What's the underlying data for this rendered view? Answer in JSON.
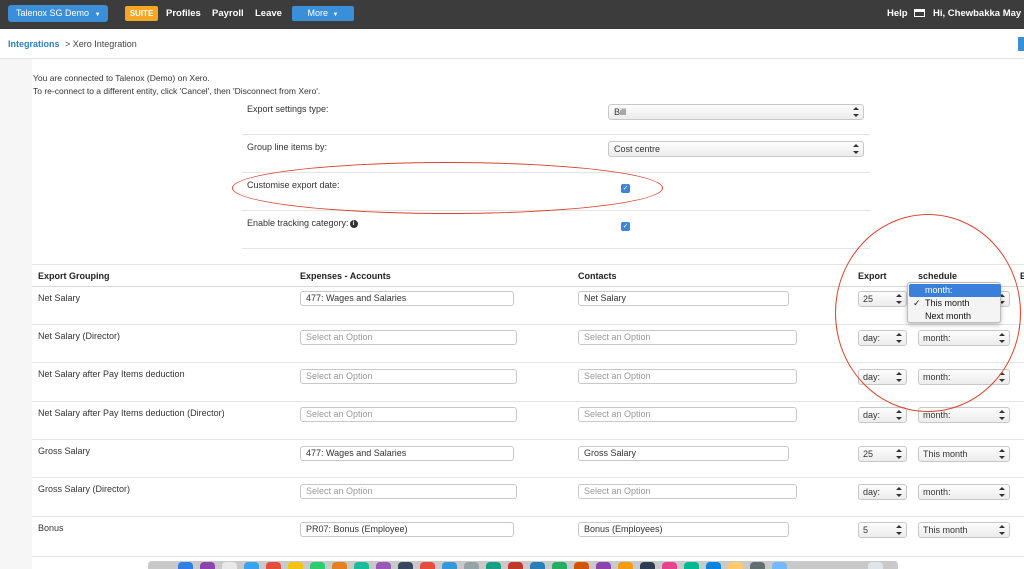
{
  "topnav": {
    "org_label": "Talenox SG Demo",
    "suite_label": "SUITE",
    "links": [
      "Profiles",
      "Payroll",
      "Leave"
    ],
    "more_label": "More",
    "help_label": "Help",
    "greeting": "Hi, Chewbakka May"
  },
  "breadcrumb": {
    "parent": "Integrations",
    "current": "> Xero Integration"
  },
  "info": {
    "line1": "You are connected to Talenox (Demo) on Xero.",
    "line2": "To re-connect to a different entity, click 'Cancel', then 'Disconnect from Xero'."
  },
  "settings": {
    "export_type_label": "Export settings type:",
    "export_type_value": "Bill",
    "group_by_label": "Group line items by:",
    "group_by_value": "Cost centre",
    "customise_date_label": "Customise export date:",
    "customise_date_checked": true,
    "tracking_label": "Enable tracking category:",
    "tracking_checked": true
  },
  "table": {
    "headers": {
      "grouping": "Export Grouping",
      "accounts": "Expenses - Accounts",
      "contacts": "Contacts",
      "export": "Export",
      "schedule": "schedule",
      "extra": "E"
    },
    "rows": [
      {
        "label": "Net Salary",
        "account": "477: Wages and Salaries",
        "account_placeholder": false,
        "contact": "Net Salary",
        "contact_placeholder": false,
        "day": "25",
        "schedule": "This month"
      },
      {
        "label": "Net Salary (Director)",
        "account": "Select an Option",
        "account_placeholder": true,
        "contact": "Select an Option",
        "contact_placeholder": true,
        "day": "day:",
        "schedule": "month:"
      },
      {
        "label": "Net Salary after Pay Items deduction",
        "account": "Select an Option",
        "account_placeholder": true,
        "contact": "Select an Option",
        "contact_placeholder": true,
        "day": "day:",
        "schedule": "month:"
      },
      {
        "label": "Net Salary after Pay Items deduction (Director)",
        "account": "Select an Option",
        "account_placeholder": true,
        "contact": "Select an Option",
        "contact_placeholder": true,
        "day": "day:",
        "schedule": "month:"
      },
      {
        "label": "Gross Salary",
        "account": "477: Wages and Salaries",
        "account_placeholder": false,
        "contact": "Gross Salary",
        "contact_placeholder": false,
        "day": "25",
        "schedule": "This month"
      },
      {
        "label": "Gross Salary (Director)",
        "account": "Select an Option",
        "account_placeholder": true,
        "contact": "Select an Option",
        "contact_placeholder": true,
        "day": "day:",
        "schedule": "month:"
      },
      {
        "label": "Bonus",
        "account": "PR07: Bonus (Employee)",
        "account_placeholder": false,
        "contact": "Bonus (Employees)",
        "contact_placeholder": false,
        "day": "5",
        "schedule": "This month"
      }
    ]
  },
  "schedule_dropdown": {
    "options": [
      "month:",
      "This month",
      "Next month"
    ],
    "highlighted": "month:",
    "checked": "This month"
  },
  "colors": {
    "nav_bg": "#3c3c3c",
    "accent_blue": "#3a8fd8",
    "suite_orange": "#f5a623",
    "annotation_red": "#d9442c"
  }
}
